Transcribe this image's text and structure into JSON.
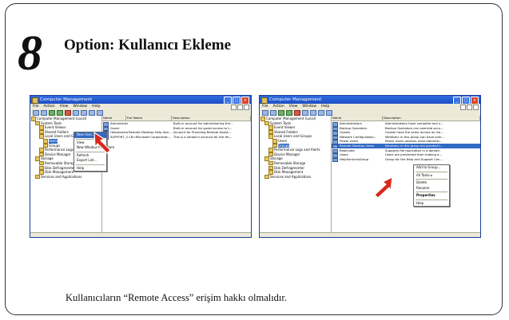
{
  "step": {
    "number": "8",
    "title": "Option: Kullanıcı Ekleme"
  },
  "caption": "Kullanıcıların “Remote Access” erişim hakkı olmalıdır.",
  "colors": {
    "titlebar": "#1c4fc4",
    "selection": "#316ac5",
    "close": "#d8462c",
    "arrow": "#d8281c"
  },
  "screenshots": [
    {
      "window_title": "Computer Management",
      "menu": [
        "File",
        "Action",
        "View",
        "Window",
        "Help"
      ],
      "tree": [
        {
          "label": "Computer Management (Local)",
          "indent": 0
        },
        {
          "label": "System Tools",
          "indent": 1
        },
        {
          "label": "Event Viewer",
          "indent": 2
        },
        {
          "label": "Shared Folders",
          "indent": 2
        },
        {
          "label": "Local Users and Groups",
          "indent": 2
        },
        {
          "label": "Users",
          "indent": 3,
          "selected": true
        },
        {
          "label": "Groups",
          "indent": 3
        },
        {
          "label": "Performance Logs and Alerts",
          "indent": 2
        },
        {
          "label": "Device Manager",
          "indent": 2
        },
        {
          "label": "Storage",
          "indent": 1
        },
        {
          "label": "Removable Storage",
          "indent": 2
        },
        {
          "label": "Disk Defragmenter",
          "indent": 2
        },
        {
          "label": "Disk Management",
          "indent": 2
        },
        {
          "label": "Services and Applications",
          "indent": 1
        }
      ],
      "columns": [
        "Name",
        "Full Name",
        "Description"
      ],
      "rows": [
        [
          "Administrator",
          "",
          "Built-in account for administering the..."
        ],
        [
          "Guest",
          "",
          "Built-in account for guest access to t..."
        ],
        [
          "HelpAssistant",
          "Remote Desktop Help Assi...",
          "Account for Providing Remote Assist..."
        ],
        [
          "SUPPORT_38...",
          "CN=Microsoft Corporation...",
          "This is a vendor's account for the He..."
        ]
      ],
      "context_menu": [
        {
          "label": "New User...",
          "highlight": true
        },
        {
          "sep": true
        },
        {
          "label": "View"
        },
        {
          "label": "New Window from Here"
        },
        {
          "sep": true
        },
        {
          "label": "Refresh"
        },
        {
          "label": "Export List..."
        },
        {
          "sep": true
        },
        {
          "label": "Help"
        }
      ]
    },
    {
      "window_title": "Computer Management",
      "menu": [
        "File",
        "Action",
        "View",
        "Window",
        "Help"
      ],
      "tree": [
        {
          "label": "Computer Management (Local)",
          "indent": 0
        },
        {
          "label": "System Tools",
          "indent": 1
        },
        {
          "label": "Event Viewer",
          "indent": 2
        },
        {
          "label": "Shared Folders",
          "indent": 2
        },
        {
          "label": "Local Users and Groups",
          "indent": 2
        },
        {
          "label": "Users",
          "indent": 3
        },
        {
          "label": "Groups",
          "indent": 3,
          "selected": true
        },
        {
          "label": "Performance Logs and Alerts",
          "indent": 2
        },
        {
          "label": "Device Manager",
          "indent": 2
        },
        {
          "label": "Storage",
          "indent": 1
        },
        {
          "label": "Removable Storage",
          "indent": 2
        },
        {
          "label": "Disk Defragmenter",
          "indent": 2
        },
        {
          "label": "Disk Management",
          "indent": 2
        },
        {
          "label": "Services and Applications",
          "indent": 1
        }
      ],
      "columns": [
        "Name",
        "Description"
      ],
      "rows": [
        [
          "Administrators",
          "Administrators have complete and u..."
        ],
        [
          "Backup Operators",
          "Backup Operators can override secu..."
        ],
        [
          "Guests",
          "Guests have the same access as me..."
        ],
        [
          "Network Configuration...",
          "Members in this group can have som..."
        ],
        [
          "Power Users",
          "Power Users possess most administ..."
        ],
        [
          "Remote Desktop Users",
          "Members in this group are granted t...",
          "selected"
        ],
        [
          "Replicator",
          "Supports file replication in a domain"
        ],
        [
          "Users",
          "Users are prevented from making a..."
        ],
        [
          "HelpServicesGroup",
          "Group for the Help and Support Cen..."
        ]
      ],
      "context_menu": [
        {
          "label": "Add to Group..."
        },
        {
          "sep": true
        },
        {
          "label": "All Tasks ▸"
        },
        {
          "sep": true
        },
        {
          "label": "Delete"
        },
        {
          "label": "Rename"
        },
        {
          "sep": true
        },
        {
          "label": "Properties",
          "bold": true
        },
        {
          "sep": true
        },
        {
          "label": "Help"
        }
      ]
    }
  ]
}
